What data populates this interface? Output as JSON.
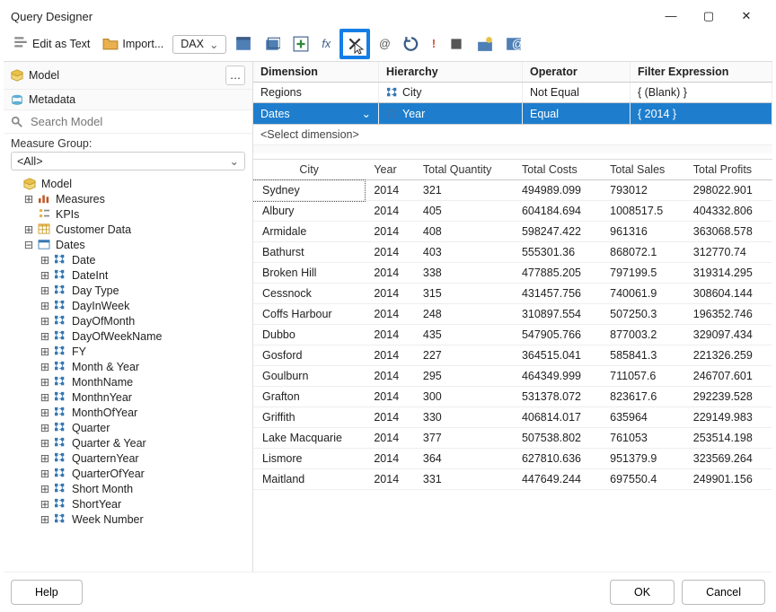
{
  "window": {
    "title": "Query Designer"
  },
  "toolbar": {
    "edit_as_text": "Edit as Text",
    "import": "Import...",
    "language": "DAX"
  },
  "panels": {
    "model": "Model",
    "metadata": "Metadata",
    "search_placeholder": "Search Model",
    "measure_group_label": "Measure Group:",
    "measure_group_value": "<All>"
  },
  "tree": {
    "model": "Model",
    "measures": "Measures",
    "kpis": "KPIs",
    "customer": "Customer Data",
    "dates": "Dates",
    "date_children": [
      "Date",
      "DateInt",
      "Day Type",
      "DayInWeek",
      "DayOfMonth",
      "DayOfWeekName",
      "FY",
      "Month & Year",
      "MonthName",
      "MonthnYear",
      "MonthOfYear",
      "Quarter",
      "Quarter & Year",
      "QuarternYear",
      "QuarterOfYear",
      "Short Month",
      "ShortYear",
      "Week Number"
    ]
  },
  "filters": {
    "head": {
      "dimension": "Dimension",
      "hierarchy": "Hierarchy",
      "operator": "Operator",
      "expr": "Filter Expression"
    },
    "rows": [
      {
        "dimension": "Regions",
        "hierarchy": "City",
        "operator": "Not Equal",
        "expr": "{ (Blank) }"
      },
      {
        "dimension": "Dates",
        "hierarchy": "Year",
        "operator": "Equal",
        "expr": "{ 2014 }"
      }
    ],
    "placeholder": "<Select dimension>"
  },
  "grid": {
    "columns": [
      "City",
      "Year",
      "Total Quantity",
      "Total Costs",
      "Total Sales",
      "Total Profits"
    ],
    "rows": [
      [
        "Sydney",
        "2014",
        "321",
        "494989.099",
        "793012",
        "298022.901"
      ],
      [
        "Albury",
        "2014",
        "405",
        "604184.694",
        "1008517.5",
        "404332.806"
      ],
      [
        "Armidale",
        "2014",
        "408",
        "598247.422",
        "961316",
        "363068.578"
      ],
      [
        "Bathurst",
        "2014",
        "403",
        "555301.36",
        "868072.1",
        "312770.74"
      ],
      [
        "Broken Hill",
        "2014",
        "338",
        "477885.205",
        "797199.5",
        "319314.295"
      ],
      [
        "Cessnock",
        "2014",
        "315",
        "431457.756",
        "740061.9",
        "308604.144"
      ],
      [
        "Coffs Harbour",
        "2014",
        "248",
        "310897.554",
        "507250.3",
        "196352.746"
      ],
      [
        "Dubbo",
        "2014",
        "435",
        "547905.766",
        "877003.2",
        "329097.434"
      ],
      [
        "Gosford",
        "2014",
        "227",
        "364515.041",
        "585841.3",
        "221326.259"
      ],
      [
        "Goulburn",
        "2014",
        "295",
        "464349.999",
        "711057.6",
        "246707.601"
      ],
      [
        "Grafton",
        "2014",
        "300",
        "531378.072",
        "823617.6",
        "292239.528"
      ],
      [
        "Griffith",
        "2014",
        "330",
        "406814.017",
        "635964",
        "229149.983"
      ],
      [
        "Lake Macquarie",
        "2014",
        "377",
        "507538.802",
        "761053",
        "253514.198"
      ],
      [
        "Lismore",
        "2014",
        "364",
        "627810.636",
        "951379.9",
        "323569.264"
      ],
      [
        "Maitland",
        "2014",
        "331",
        "447649.244",
        "697550.4",
        "249901.156"
      ]
    ]
  },
  "footer": {
    "help": "Help",
    "ok": "OK",
    "cancel": "Cancel"
  }
}
